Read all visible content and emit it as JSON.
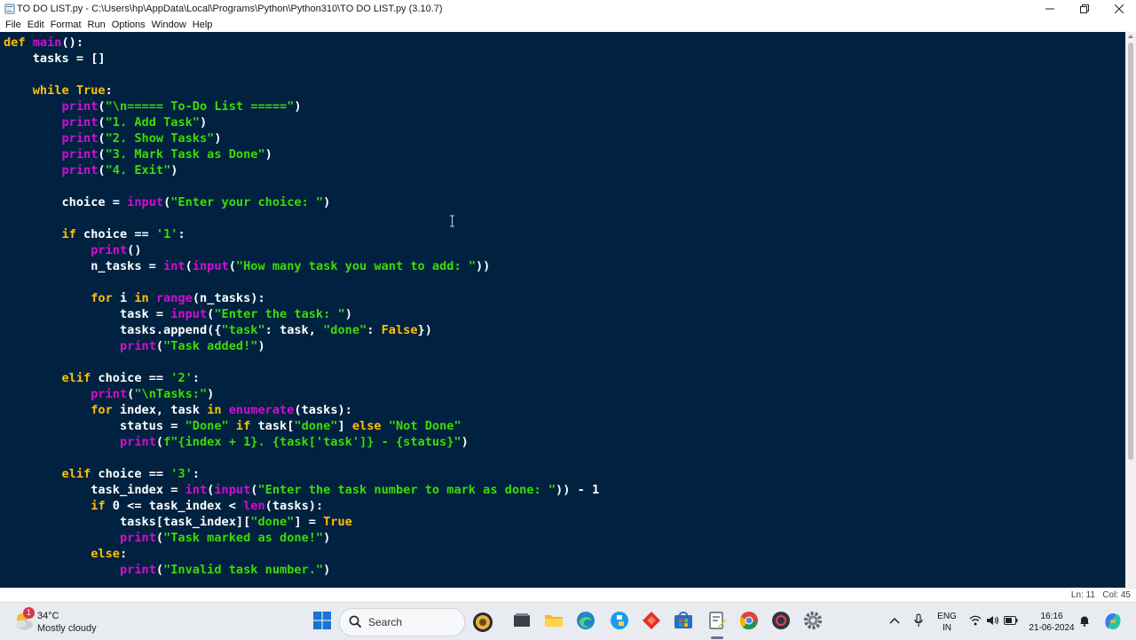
{
  "window": {
    "title": "TO DO LIST.py - C:\\Users\\hp\\AppData\\Local\\Programs\\Python\\Python310\\TO DO LIST.py (3.10.7)"
  },
  "menu": [
    "File",
    "Edit",
    "Format",
    "Run",
    "Options",
    "Window",
    "Help"
  ],
  "code_lines": [
    "def main():",
    "    tasks = []",
    "",
    "    while True:",
    "        print(\"\\n===== To-Do List =====\")",
    "        print(\"1. Add Task\")",
    "        print(\"2. Show Tasks\")",
    "        print(\"3. Mark Task as Done\")",
    "        print(\"4. Exit\")",
    "",
    "        choice = input(\"Enter your choice: \")",
    "",
    "        if choice == '1':",
    "            print()",
    "            n_tasks = int(input(\"How many task you want to add: \"))",
    "",
    "            for i in range(n_tasks):",
    "                task = input(\"Enter the task: \")",
    "                tasks.append({\"task\": task, \"done\": False})",
    "                print(\"Task added!\")",
    "",
    "        elif choice == '2':",
    "            print(\"\\nTasks:\")",
    "            for index, task in enumerate(tasks):",
    "                status = \"Done\" if task[\"done\"] else \"Not Done\"",
    "                print(f\"{index + 1}. {task['task']} - {status}\")",
    "",
    "        elif choice == '3':",
    "            task_index = int(input(\"Enter the task number to mark as done: \")) - 1",
    "            if 0 <= task_index < len(tasks):",
    "                tasks[task_index][\"done\"] = True",
    "                print(\"Task marked as done!\")",
    "            else:",
    "                print(\"Invalid task number.\")"
  ],
  "status": {
    "position": "Ln: 11   Col: 45"
  },
  "taskbar": {
    "weather_temp": "34°C",
    "weather_desc": "Mostly cloudy",
    "weather_badge": "1",
    "search_label": "Search",
    "lang_top": "ENG",
    "lang_bottom": "IN",
    "time": "16:16",
    "date": "21-06-2024"
  },
  "colors": {
    "editor_bg": "#002240",
    "keyword": "#ffbf00",
    "builtin": "#d40cd4",
    "string": "#3ddb00",
    "text": "#ffffff"
  }
}
